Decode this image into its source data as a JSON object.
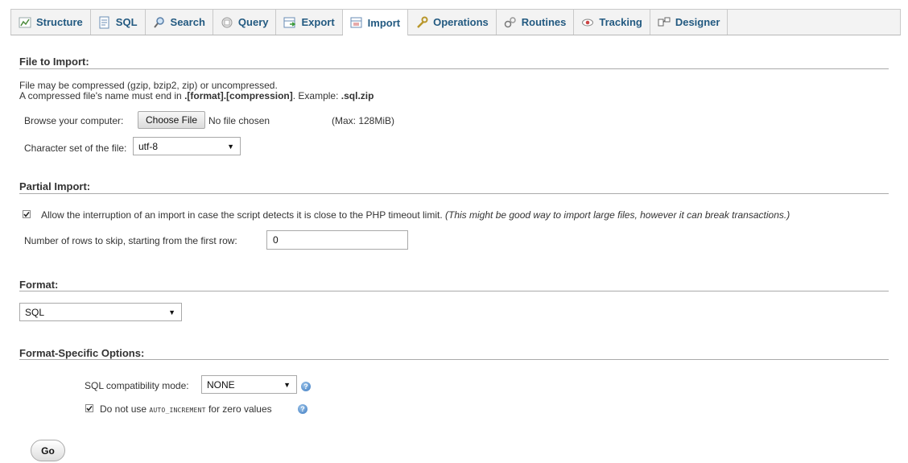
{
  "tabs": [
    {
      "label": "Structure",
      "icon": "structure-icon"
    },
    {
      "label": "SQL",
      "icon": "sql-icon"
    },
    {
      "label": "Search",
      "icon": "search-icon"
    },
    {
      "label": "Query",
      "icon": "query-icon"
    },
    {
      "label": "Export",
      "icon": "export-icon"
    },
    {
      "label": "Import",
      "icon": "import-icon",
      "active": true
    },
    {
      "label": "Operations",
      "icon": "wrench-icon"
    },
    {
      "label": "Routines",
      "icon": "routines-icon"
    },
    {
      "label": "Tracking",
      "icon": "eye-icon"
    },
    {
      "label": "Designer",
      "icon": "designer-icon"
    }
  ],
  "file_import": {
    "title": "File to Import:",
    "note_line1": "File may be compressed (gzip, bzip2, zip) or uncompressed.",
    "note_line2_prefix": "A compressed file's name must end in ",
    "note_line2_format": ".[format].[compression]",
    "note_line2_mid": ". Example: ",
    "note_line2_example": ".sql.zip",
    "browse_label": "Browse your computer:",
    "choose_file_button": "Choose File",
    "no_file_text": "No file chosen",
    "max_size": "(Max: 128MiB)",
    "charset_label": "Character set of the file:",
    "charset_value": "utf-8"
  },
  "partial_import": {
    "title": "Partial Import:",
    "allow_interrupt_checked": true,
    "allow_interrupt_label": "Allow the interruption of an import in case the script detects it is close to the PHP timeout limit.",
    "allow_interrupt_note": "(This might be good way to import large files, however it can break transactions.)",
    "skip_rows_label": "Number of rows to skip, starting from the first row:",
    "skip_rows_value": "0"
  },
  "format": {
    "title": "Format:",
    "value": "SQL"
  },
  "format_options": {
    "title": "Format-Specific Options:",
    "compat_label": "SQL compatibility mode:",
    "compat_value": "NONE",
    "auto_increment_checked": true,
    "auto_increment_prefix": "Do not use ",
    "auto_increment_code": "AUTO_INCREMENT",
    "auto_increment_suffix": " for zero values"
  },
  "go_button": "Go",
  "colors": {
    "tab_text": "#235a81",
    "help_icon": "#3a78c0"
  }
}
